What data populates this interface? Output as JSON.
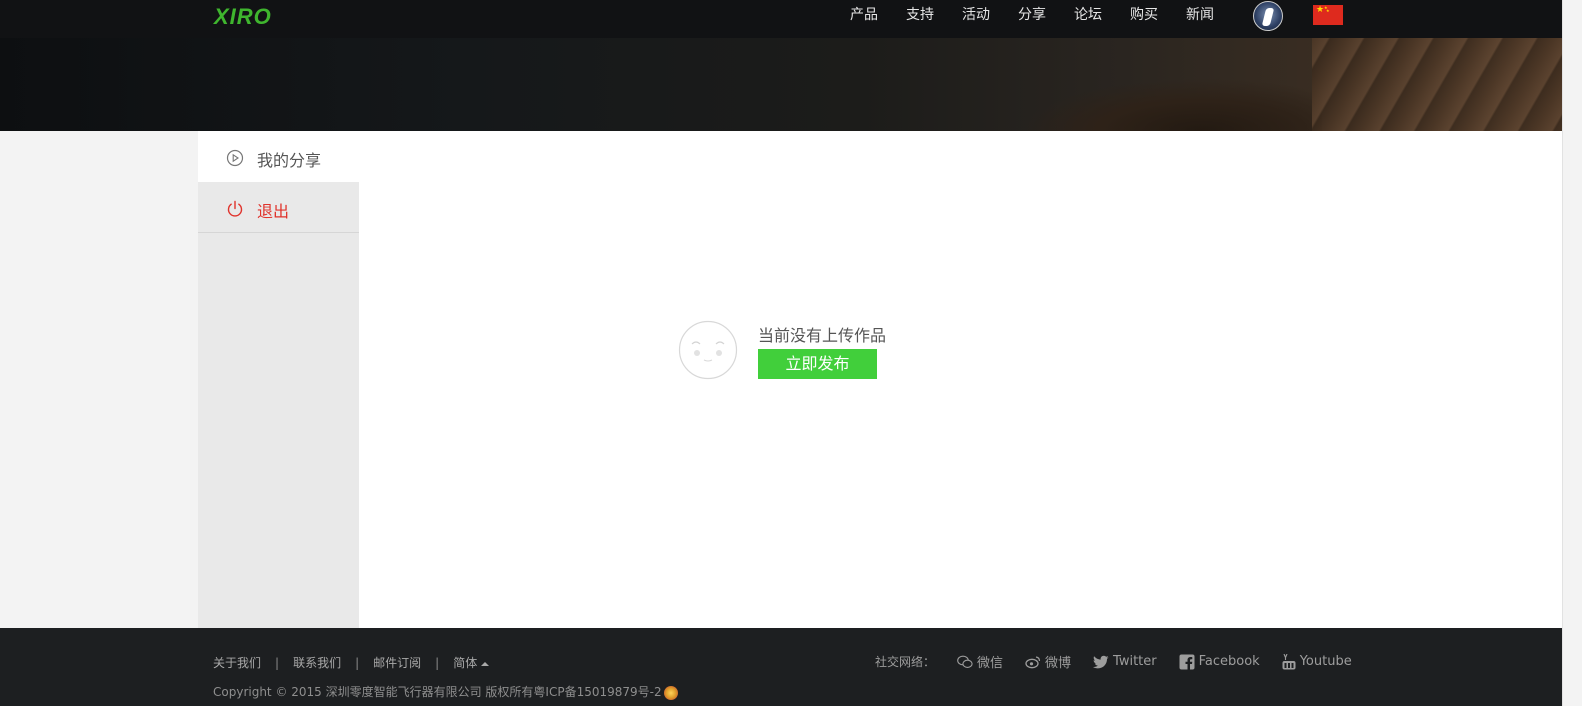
{
  "header": {
    "logo": "XIRO",
    "nav": [
      "产品",
      "支持",
      "活动",
      "分享",
      "论坛",
      "购买",
      "新闻"
    ]
  },
  "sidebar": {
    "items": [
      {
        "label": "我的分享",
        "icon": "play-circle-icon",
        "color": "#555555"
      },
      {
        "label": "退出",
        "icon": "power-icon",
        "color": "#e0332c"
      }
    ]
  },
  "main": {
    "empty_text": "当前没有上传作品",
    "publish_label": "立即发布",
    "accent": "#41cf3b"
  },
  "footer": {
    "links": [
      "关于我们",
      "联系我们",
      "邮件订阅",
      "简体"
    ],
    "copyright": "Copyright © 2015 深圳零度智能飞行器有限公司 版权所有粤ICP备15019879号-2",
    "social_label": "社交网络：",
    "social": [
      {
        "label": "微信",
        "icon": "wechat-icon"
      },
      {
        "label": "微博",
        "icon": "weibo-icon"
      },
      {
        "label": "Twitter",
        "icon": "twitter-icon"
      },
      {
        "label": "Facebook",
        "icon": "facebook-icon"
      },
      {
        "label": "Youtube",
        "icon": "youtube-icon"
      }
    ]
  },
  "colors": {
    "brand": "#3fb52e",
    "topbar": "#111214",
    "footer": "#1d1f21"
  }
}
